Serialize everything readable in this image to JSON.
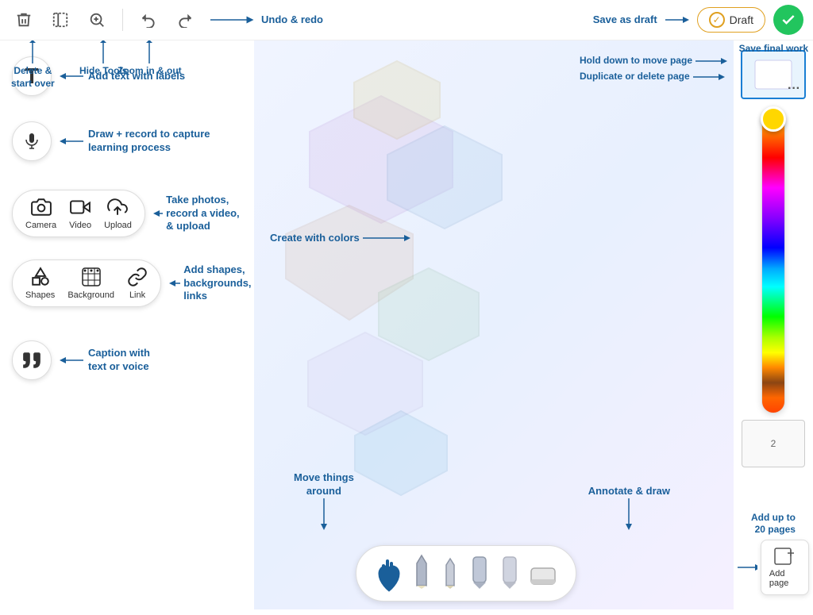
{
  "toolbar": {
    "delete_label": "🗑",
    "hide_tools_label": "⊡",
    "zoom_in_label": "⊕",
    "undo_label": "↩",
    "redo_label": "↪",
    "save_draft_label": "Draft",
    "save_final_label": "✓"
  },
  "annotations": {
    "delete": "Delete &\nstart over",
    "hide_tools": "Hide Tools",
    "zoom": "Zoom in & out",
    "undo_redo": "Undo & redo",
    "save_draft": "Save as draft",
    "save_final": "Save final work",
    "hold_move": "Hold down to move page",
    "duplicate": "Duplicate or delete page",
    "add_text": "Add text with labels",
    "draw_record": "Draw + record to capture\nlearning process",
    "take_photos": "Take photos, record a video, & upload",
    "shapes_bg": "Add shapes, backgrounds, & links",
    "create_colors": "Create with colors",
    "move_things": "Move things\naround",
    "annotate_draw": "Annotate & draw",
    "caption": "Caption with\ntext or voice",
    "add_pages": "Add up to\n20 pages"
  },
  "tools": {
    "camera_label": "Camera",
    "video_label": "Video",
    "upload_label": "Upload",
    "shapes_label": "Shapes",
    "background_label": "Background",
    "link_label": "Link",
    "add_page_label": "Add page"
  },
  "pages": {
    "page2_label": "2"
  }
}
